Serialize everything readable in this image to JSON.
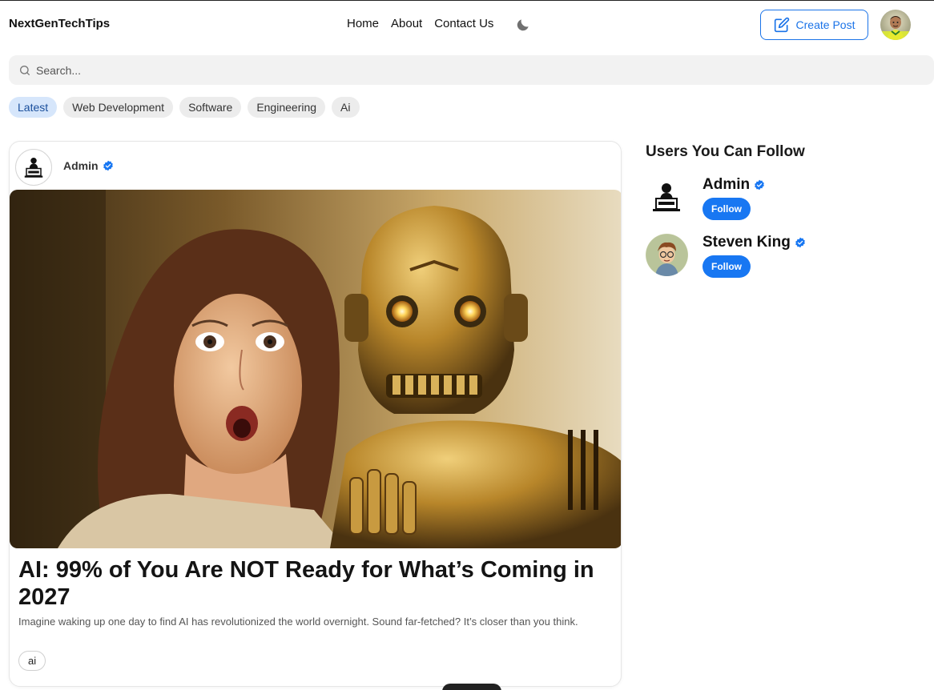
{
  "header": {
    "brand": "NextGenTechTips",
    "nav": [
      "Home",
      "About",
      "Contact Us"
    ],
    "theme_icon": "moon-icon",
    "create_post_label": "Create Post",
    "create_post_icon": "edit-icon"
  },
  "search": {
    "placeholder": "Search...",
    "icon": "search-icon"
  },
  "tags": {
    "items": [
      "Latest",
      "Web Development",
      "Software",
      "Engineering",
      "Ai"
    ],
    "active": "Latest"
  },
  "post": {
    "author": "Admin",
    "verified_icon": "verified-badge-icon",
    "title": "AI: 99% of You Are NOT Ready for What’s Coming in 2027",
    "excerpt": "Imagine waking up one day to find AI has revolutionized the world overnight. Sound far-fetched? It’s closer than you think.",
    "tag": "ai"
  },
  "sidebar": {
    "title": "Users You Can Follow",
    "users": [
      {
        "name": "Admin",
        "follow_label": "Follow"
      },
      {
        "name": "Steven King",
        "follow_label": "Follow"
      }
    ]
  },
  "colors": {
    "accent": "#1877f2",
    "verified": "#1877f2",
    "active_tag_bg": "#d6e6fb",
    "tag_bg": "#ececec",
    "search_bg": "#f2f2f2"
  }
}
